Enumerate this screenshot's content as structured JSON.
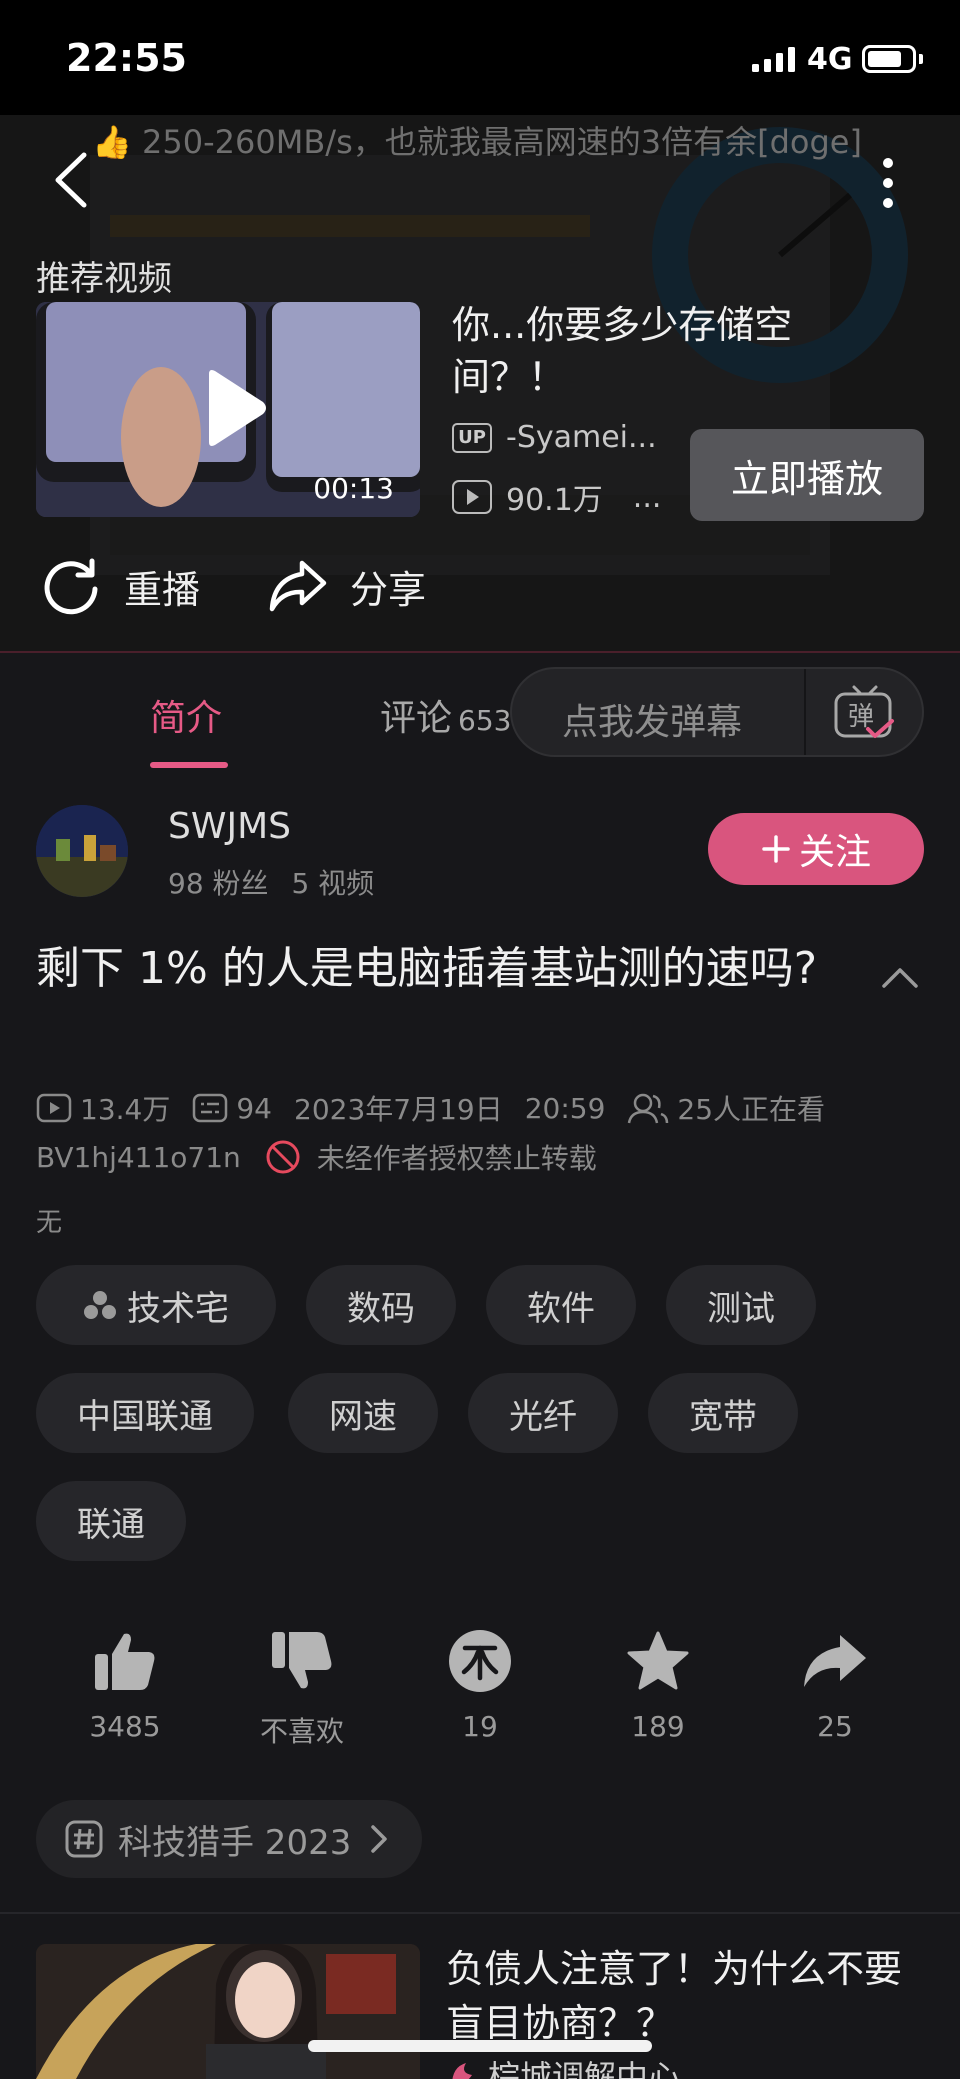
{
  "status_bar": {
    "time": "22:55",
    "network": "4G",
    "battery_level": 0.78
  },
  "video": {
    "danmaku_text": "👍 250-260MB/s，也就我最高网速的3倍有余[doge]",
    "recommend_label": "推荐视频",
    "recommended": {
      "duration": "00:13",
      "title": "你...你要多少存储空间？！",
      "up_name": "-Syamei...",
      "views": "90.1万",
      "more": "...",
      "play_now_label": "立即播放"
    },
    "replay_label": "重播",
    "share_label": "分享"
  },
  "tabs": {
    "intro_label": "简介",
    "comments_label": "评论",
    "comments_count": "653",
    "danmaku_placeholder": "点我发弹幕",
    "danmaku_toggle_char": "弹"
  },
  "author": {
    "name": "SWJMS",
    "fans": "98 粉丝",
    "videos": "5 视频",
    "follow_label": "关注"
  },
  "details": {
    "title": "剩下 1% 的人是电脑插着基站测的速吗?",
    "plays": "13.4万",
    "danmaku_count": "94",
    "date": "2023年7月19日",
    "time": "20:59",
    "watching": "25人正在看",
    "bvid": "BV1hj411o71n",
    "copyright_notice": "未经作者授权禁止转载",
    "description": "无"
  },
  "tags": [
    "技术宅",
    "数码",
    "软件",
    "测试",
    "中国联通",
    "网速",
    "光纤",
    "宽带",
    "联通"
  ],
  "actions": {
    "like": "3485",
    "dislike": "不喜欢",
    "coin": "19",
    "favorite": "189",
    "share": "25"
  },
  "topic": {
    "label": "科技猎手 2023"
  },
  "next_recommendation": {
    "title": "负债人注意了！为什么不要盲目协商？？",
    "up_name": "棕城调解中心"
  },
  "colors": {
    "accent": "#e65a86",
    "follow_bg": "#d9557e",
    "background": "#17171a"
  }
}
